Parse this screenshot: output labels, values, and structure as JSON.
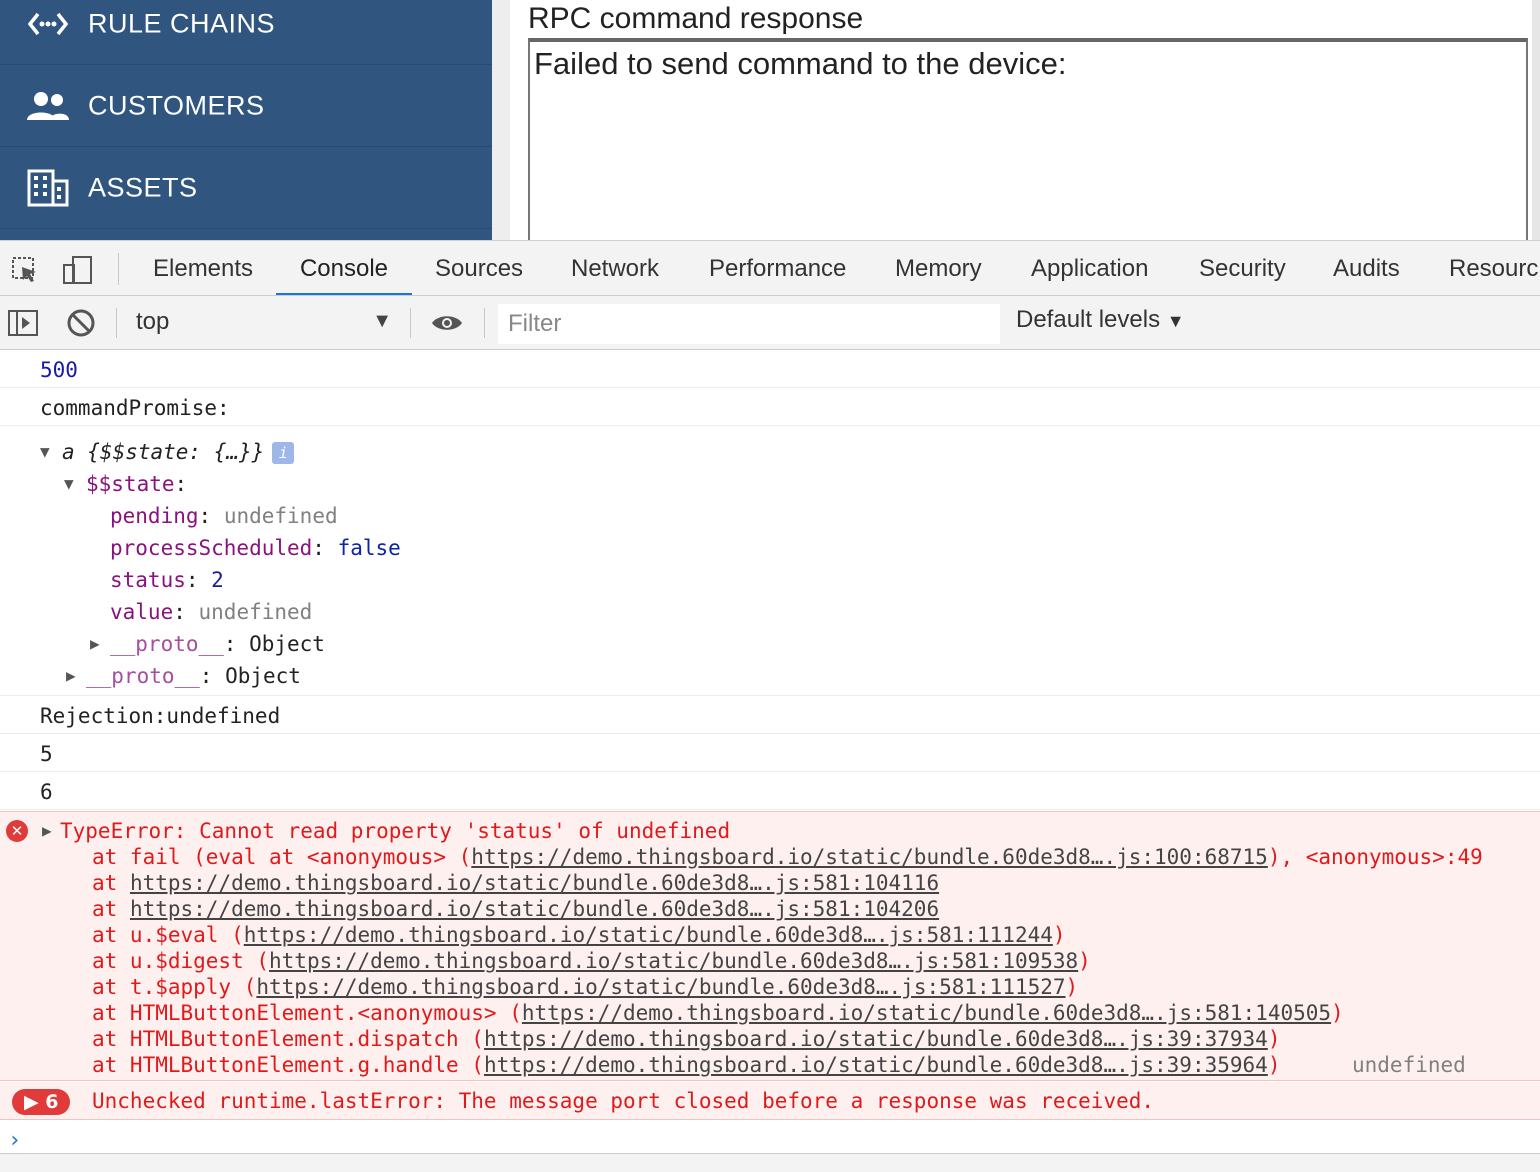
{
  "sidebar": {
    "items": [
      {
        "label": "RULE CHAINS",
        "icon": "rule-chain-icon"
      },
      {
        "label": "CUSTOMERS",
        "icon": "customers-icon"
      },
      {
        "label": "ASSETS",
        "icon": "assets-icon"
      }
    ]
  },
  "rpc": {
    "title": "RPC command response",
    "response": "Failed to send command to the device:"
  },
  "devtools": {
    "tabs": [
      "Elements",
      "Console",
      "Sources",
      "Network",
      "Performance",
      "Memory",
      "Application",
      "Security",
      "Audits",
      "Resourc"
    ],
    "active_tab": "Console",
    "context": "top",
    "filter_placeholder": "Filter",
    "levels_label": "Default levels"
  },
  "console": {
    "num500": "500",
    "command_promise": "commandPromise:",
    "obj_header": "a {$$state: {…}}",
    "state_key": "$$state",
    "pending_key": "pending",
    "pending_val": "undefined",
    "process_key": "processScheduled",
    "process_val": "false",
    "status_key": "status",
    "status_val": "2",
    "value_key": "value",
    "value_val": "undefined",
    "proto_key": "__proto__",
    "proto_val": "Object",
    "rejection": "Rejection:undefined",
    "num5": "5",
    "num6": "6",
    "error": {
      "title": "TypeError: Cannot read property 'status' of undefined",
      "lines": [
        {
          "pre": "at fail (eval at <anonymous> (",
          "link": "https://demo.thingsboard.io/static/bundle.60de3d8….js:100:68715",
          "post": "), <anonymous>:49"
        },
        {
          "pre": "at ",
          "link": "https://demo.thingsboard.io/static/bundle.60de3d8….js:581:104116",
          "post": ""
        },
        {
          "pre": "at ",
          "link": "https://demo.thingsboard.io/static/bundle.60de3d8….js:581:104206",
          "post": ""
        },
        {
          "pre": "at u.$eval (",
          "link": "https://demo.thingsboard.io/static/bundle.60de3d8….js:581:111244",
          "post": ")"
        },
        {
          "pre": "at u.$digest (",
          "link": "https://demo.thingsboard.io/static/bundle.60de3d8….js:581:109538",
          "post": ")"
        },
        {
          "pre": "at t.$apply (",
          "link": "https://demo.thingsboard.io/static/bundle.60de3d8….js:581:111527",
          "post": ")"
        },
        {
          "pre": "at HTMLButtonElement.<anonymous> (",
          "link": "https://demo.thingsboard.io/static/bundle.60de3d8….js:581:140505",
          "post": ")"
        },
        {
          "pre": "at HTMLButtonElement.dispatch (",
          "link": "https://demo.thingsboard.io/static/bundle.60de3d8….js:39:37934",
          "post": ")"
        },
        {
          "pre": "at HTMLButtonElement.g.handle (",
          "link": "https://demo.thingsboard.io/static/bundle.60de3d8….js:39:35964",
          "post": ")"
        }
      ],
      "trailing": "undefined"
    },
    "warning": {
      "count": "6",
      "text": "Unchecked runtime.lastError: The message port closed before a response was received."
    }
  },
  "colors": {
    "sidebar_bg": "#305680",
    "error_red": "#e01a1a",
    "error_bg": "#fff0f0",
    "accent_blue": "#1a73e8",
    "prop_purple": "#881280"
  }
}
